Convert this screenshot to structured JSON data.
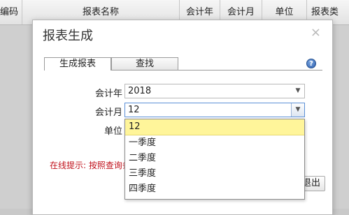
{
  "grid": {
    "columns": [
      "编码",
      "报表名称",
      "会计年",
      "会计月",
      "单位",
      "报表类"
    ]
  },
  "dialog": {
    "title": "报表生成",
    "close_glyph": "×",
    "tabs": [
      "生成报表",
      "查找"
    ],
    "help_glyph": "?",
    "year_label": "会计年",
    "year_value": "2018",
    "month_label": "会计月",
    "month_value": "12",
    "unit_label": "单位",
    "hint": "在线提示: 按照查询条",
    "exit_label": "退出"
  },
  "month_dropdown": {
    "options": [
      "12",
      "一季度",
      "二季度",
      "三季度",
      "四季度"
    ],
    "selected_index": 0
  }
}
